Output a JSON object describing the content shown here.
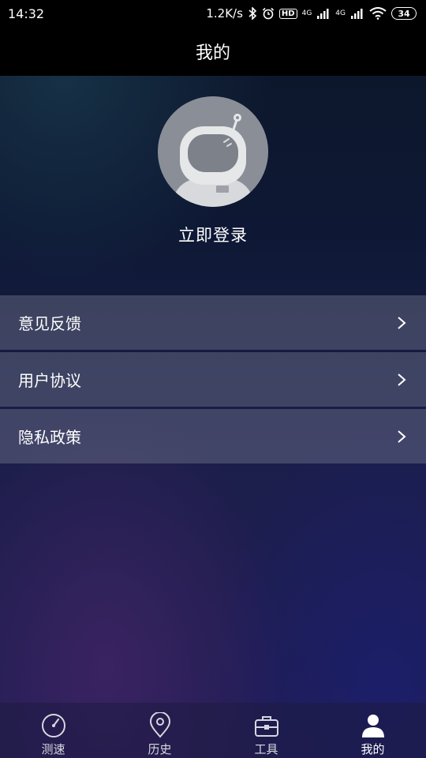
{
  "status_bar": {
    "time": "14:32",
    "net_speed": "1.2K/s",
    "hd_label": "HD",
    "signal1_label": "4G",
    "signal2_label": "4G",
    "battery": "34"
  },
  "header": {
    "title": "我的"
  },
  "profile": {
    "login_label": "立即登录"
  },
  "menu": {
    "items": [
      {
        "label": "意见反馈"
      },
      {
        "label": "用户协议"
      },
      {
        "label": "隐私政策"
      }
    ]
  },
  "tabs": [
    {
      "label": "测速",
      "icon": "speedometer-icon"
    },
    {
      "label": "历史",
      "icon": "location-pin-icon"
    },
    {
      "label": "工具",
      "icon": "toolbox-icon"
    },
    {
      "label": "我的",
      "icon": "user-icon",
      "active": true
    }
  ]
}
